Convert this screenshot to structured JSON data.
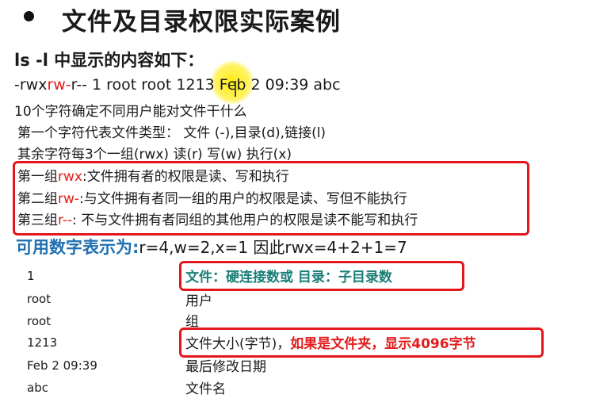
{
  "title": "文件及目录权限实际案例",
  "subtitle": "ls -l 中显示的内容如下：",
  "perm_line": {
    "part1": "-rwx",
    "part2": "rw-",
    "part3": "r-- 1 root root 1213 Feb 2 09:39 abc"
  },
  "lines": [
    "10个字符确定不同用户能对文件干什么",
    "第一个字符代表文件类型： 文件 (-),目录(d),链接(l)",
    "其余字符每3个一组(rwx) 读(r) 写(w) 执行(x)"
  ],
  "groups": [
    {
      "prefix": "第一组",
      "code": "rwx",
      "text": ":文件拥有者的权限是读、写和执行"
    },
    {
      "prefix": "第二组",
      "code": "rw-",
      "text": ":与文件拥有者同一组的用户的权限是读、写但不能执行"
    },
    {
      "prefix": "第三组",
      "code": "r--",
      "text": ": 不与文件拥有者同组的其他用户的权限是读不能写和执行"
    }
  ],
  "numeric": {
    "label": "可用数字表示为:",
    "formula": "r=4,w=2,x=1 因此rwx=4+2+1=7"
  },
  "table": [
    {
      "key": "1",
      "desc": "文件：硬连接数或 目录：子目录数"
    },
    {
      "key": "root",
      "desc": "用户"
    },
    {
      "key": "root",
      "desc": "组"
    },
    {
      "key": "1213",
      "desc": "文件大小(字节)，",
      "desc_red": "如果是文件夹，显示4096字节"
    },
    {
      "key": "Feb 2 09:39",
      "desc": "最后修改日期"
    },
    {
      "key": "abc",
      "desc": "文件名"
    }
  ],
  "colors": {
    "accent_red": "#e21b1b",
    "box_red": "#e3161d",
    "blue": "#1f6fb2",
    "teal": "#1a7f78"
  }
}
